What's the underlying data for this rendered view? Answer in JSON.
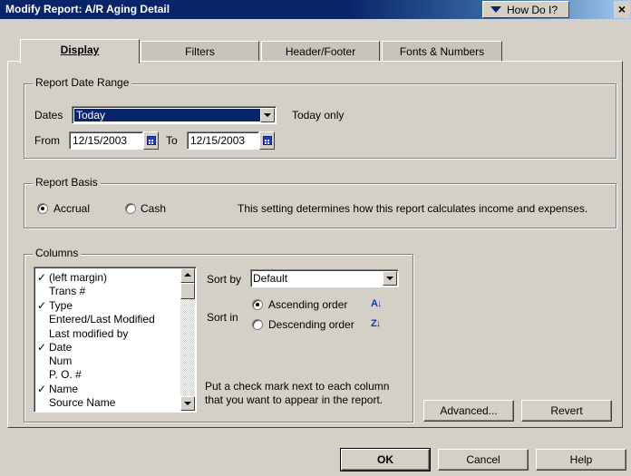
{
  "window": {
    "title": "Modify Report: A/R Aging Detail",
    "how_do_i": "How Do I?",
    "close": "×"
  },
  "tabs": [
    {
      "label": "Display",
      "active": true
    },
    {
      "label": "Filters"
    },
    {
      "label": "Header/Footer"
    },
    {
      "label": "Fonts & Numbers"
    }
  ],
  "date_range": {
    "group_label": "Report Date Range",
    "dates_label": "Dates",
    "dates_value": "Today",
    "dates_desc": "Today only",
    "from_label": "From",
    "from_value": "12/15/2003",
    "to_label": "To",
    "to_value": "12/15/2003"
  },
  "basis": {
    "group_label": "Report Basis",
    "accrual_label": "Accrual",
    "cash_label": "Cash",
    "selected": "accrual",
    "description": "This setting determines how this report calculates income and expenses."
  },
  "columns": {
    "group_label": "Columns",
    "items": [
      {
        "label": "(left margin)",
        "checked": true
      },
      {
        "label": "Trans #",
        "checked": false
      },
      {
        "label": "Type",
        "checked": true
      },
      {
        "label": "Entered/Last Modified",
        "checked": false
      },
      {
        "label": "Last modified by",
        "checked": false
      },
      {
        "label": "Date",
        "checked": true
      },
      {
        "label": "Num",
        "checked": false
      },
      {
        "label": "P. O. #",
        "checked": false
      },
      {
        "label": "Name",
        "checked": true
      },
      {
        "label": "Source Name",
        "checked": false
      }
    ],
    "checkmark": "✓",
    "sort_by_label": "Sort by",
    "sort_by_value": "Default",
    "sort_in_label": "Sort in",
    "ascending_label": "Ascending order",
    "descending_label": "Descending order",
    "ascending_icon_text": "A↓",
    "descending_icon_text": "Z↓",
    "help_line1": "Put a check mark next to each column",
    "help_line2": "that you want to appear in the report."
  },
  "buttons": {
    "advanced": "Advanced...",
    "revert": "Revert",
    "ok": "OK",
    "cancel": "Cancel",
    "help": "Help"
  }
}
